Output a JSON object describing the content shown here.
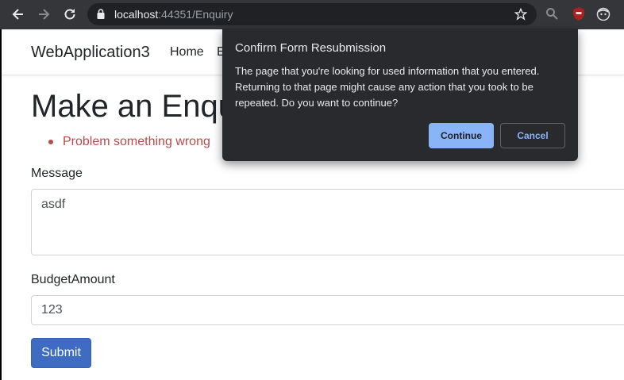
{
  "browser": {
    "url_host": "localhost",
    "url_path": ":44351/Enquiry"
  },
  "navbar": {
    "brand": "WebApplication3",
    "links": [
      "Home",
      "E"
    ]
  },
  "page": {
    "title": "Make an Enqu",
    "errors": [
      "Problem something wrong"
    ],
    "message_label": "Message",
    "message_value": "asdf",
    "budget_label": "BudgetAmount",
    "budget_value": "123",
    "submit_label": "Submit"
  },
  "dialog": {
    "title": "Confirm Form Resubmission",
    "body": "The page that you're looking for used information that you entered. Returning to that page might cause any action that you took to be repeated. Do you want to continue?",
    "continue_label": "Continue",
    "cancel_label": "Cancel"
  },
  "colors": {
    "error": "#b94a48",
    "primary": "#3e6cc2",
    "dialog_bg": "#292a2d",
    "dialog_accent": "#8ab4f8"
  }
}
